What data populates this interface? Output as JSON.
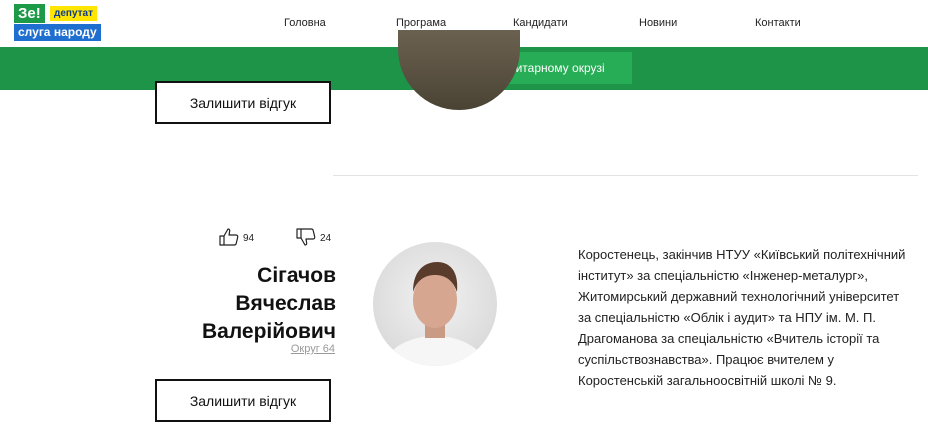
{
  "header": {
    "logo": {
      "ze": "Зе!",
      "deputat": "депутат",
      "sluga": "слуга народу"
    },
    "menu": [
      "Головна",
      "Програма",
      "Кандидати",
      "Новини",
      "Контакти"
    ],
    "district_button": "У мажоритарному окрузі"
  },
  "colors": {
    "green_bar": "#1e9448",
    "green_button": "#27ad55",
    "logo_yellow": "#ffe600",
    "logo_blue": "#1f6fd0"
  },
  "prev_candidate": {
    "feedback_button": "Залишити відгук"
  },
  "candidate": {
    "likes": "94",
    "dislikes": "24",
    "name_line1": "Сігачов",
    "name_line2": "Вячеслав",
    "name_line3": "Валерійович",
    "district": "Округ 64",
    "feedback_button": "Залишити відгук",
    "bio": "Коростенець, закінчив НТУУ «Київський політехнічний інститут» за спеціальністю «Інженер-металург», Житомирський державний технологічний університет за спеціальністю «Облік і аудит» та НПУ ім. М. П. Драгоманова за спеціальністю «Вчитель історії та суспільствознавства». Працює вчителем у Коростенській загальноосвітній школі № 9."
  }
}
